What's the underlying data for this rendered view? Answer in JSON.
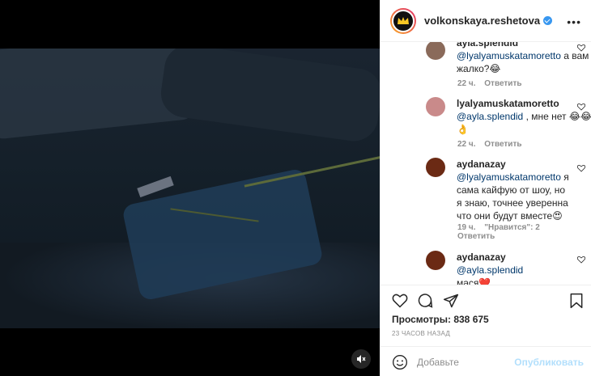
{
  "header": {
    "username": "volkonskaya.reshetova",
    "more_label": "•••"
  },
  "comments": [
    {
      "username": "ayla.splendid",
      "mention": "@lyalyamuskatamoretto",
      "text": " а вам жалко?😂",
      "time": "22 ч.",
      "reply": "Ответить",
      "likes": "",
      "avatar_color": "#8a6a5a"
    },
    {
      "username": "lyalyamuskatamoretto",
      "mention": "@ayla.splendid",
      "text": " , мне нет 😂😂👌",
      "time": "22 ч.",
      "reply": "Ответить",
      "likes": "",
      "avatar_color": "#c98a8a"
    },
    {
      "username": "aydanazay",
      "mention": "@lyalyamuskatamoretto",
      "text": " я сама кайфую от шоу, но я знаю, точнее уверенна что они будут вместе😍",
      "time": "19 ч.",
      "likes": "\"Нравится\": 2",
      "reply": "Ответить",
      "avatar_color": "#6b2a14"
    },
    {
      "username": "aydanazay",
      "mention": "@ayla.splendid",
      "text": " мася❤️",
      "time": "",
      "reply": "",
      "likes": "",
      "avatar_color": "#6b2a14"
    }
  ],
  "actions": {
    "views_label": "Просмотры: 838 675",
    "time_label": "23 ЧАСОВ НАЗАД"
  },
  "add_comment": {
    "placeholder": "Добавьте",
    "publish_label": "Опубликовать"
  },
  "icons": [
    "mute-icon",
    "heart-icon",
    "comment-icon",
    "share-icon",
    "bookmark-icon",
    "emoji-icon",
    "verified-icon",
    "more-icon"
  ]
}
